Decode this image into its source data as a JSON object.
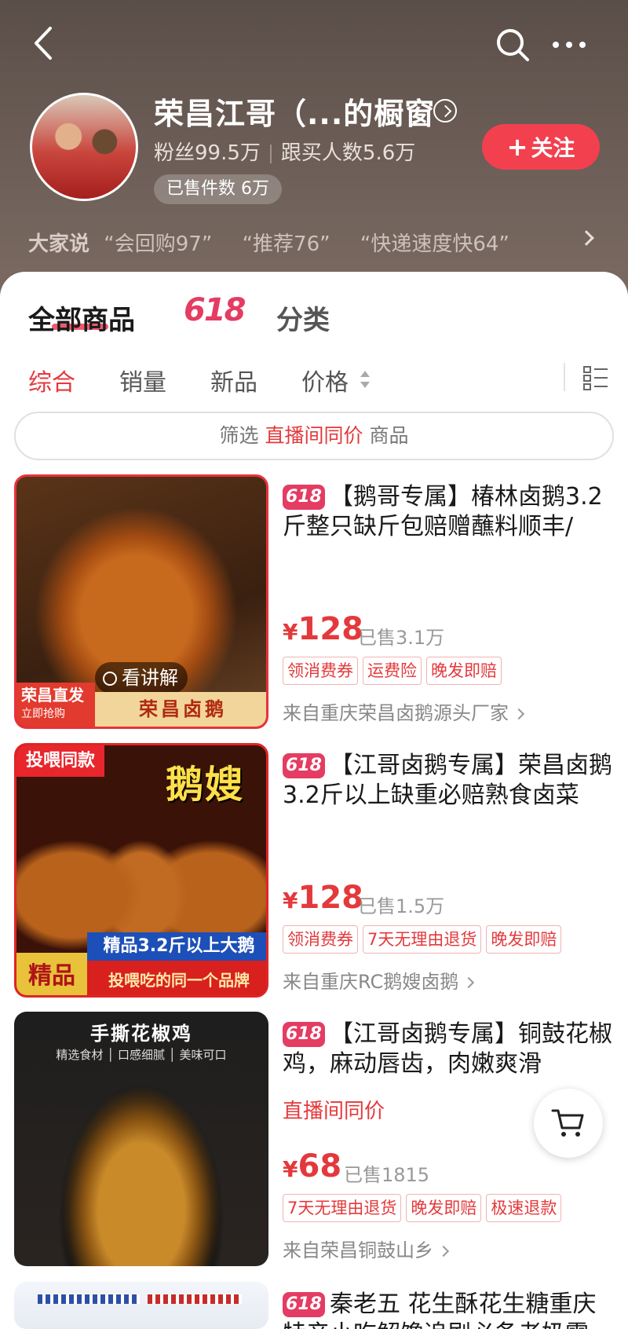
{
  "header": {
    "shop_title": "荣昌江哥（...的橱窗",
    "fans": "粉丝99.5万",
    "followers_buying": "跟买人数5.6万",
    "sold_count": "已售件数 6万",
    "follow_label": "关注",
    "reviews_lead": "大家说",
    "review_chips": [
      "“会回购97”",
      "“推荐76”",
      "“快递速度快64”"
    ]
  },
  "tabs": {
    "all": "全部商品",
    "promo": "618",
    "category": "分类"
  },
  "sort": {
    "items": [
      "综合",
      "销量",
      "新品",
      "价格"
    ],
    "active": "综合"
  },
  "filter": {
    "prefix": "筛选",
    "highlight": "直播间同价",
    "suffix": "商品"
  },
  "products": [
    {
      "badge": "618",
      "title": "【鹅哥专属】椿林卤鹅3.2斤整只缺斤包赔赠蘸料顺丰/",
      "price_symbol": "¥",
      "price": "128",
      "sold": "已售3.1万",
      "coupons": [
        "领消费券",
        "运费险",
        "晚发即赔"
      ],
      "shop": "来自重庆荣昌卤鹅源头厂家",
      "image_labels": {
        "left": "荣昌直发",
        "left_sub": "立即抢购",
        "right": "荣昌卤鹅",
        "explain": "看讲解"
      }
    },
    {
      "badge": "618",
      "title": "【江哥卤鹅专属】荣昌卤鹅3.2斤以上缺重必赔熟食卤菜",
      "price_symbol": "¥",
      "price": "128",
      "sold": "已售1.5万",
      "coupons": [
        "领消费券",
        "7天无理由退货",
        "晚发即赔"
      ],
      "shop": "来自重庆RC鹅嫂卤鹅",
      "image_labels": {
        "top": "投喂同款",
        "word": "鹅嫂",
        "band_blue": "精品3.2斤以上大鹅",
        "band_red": "投喂吃的同一个品牌",
        "corner": "精品"
      }
    },
    {
      "badge": "618",
      "title": "【江哥卤鹅专属】铜鼓花椒鸡，麻动唇齿，肉嫩爽滑",
      "live_price": "直播间同价",
      "price_symbol": "¥",
      "price": "68",
      "sold": "已售1815",
      "coupons": [
        "7天无理由退货",
        "晚发即赔",
        "极速退款"
      ],
      "shop": "来自荣昌铜鼓山乡",
      "image_labels": {
        "title": "手撕花椒鸡",
        "features": "精选食材 │ 口感细腻 │ 美味可口"
      }
    },
    {
      "badge": "618",
      "title": "秦老五 花生酥花生糖重庆特产小吃解馋追剧必备老奶零"
    }
  ],
  "colors": {
    "accent": "#e4393c",
    "promo": "#e43c62",
    "follow": "#f2404f"
  }
}
